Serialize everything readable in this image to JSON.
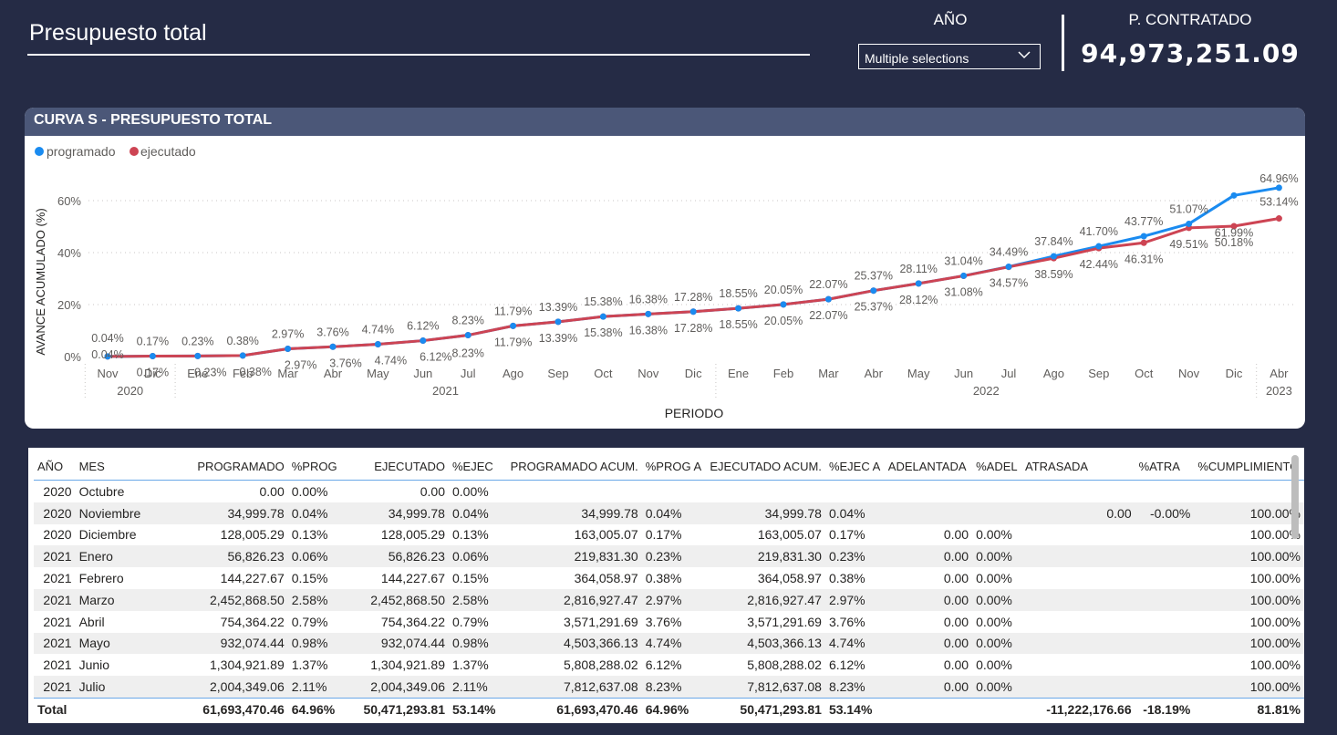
{
  "header": {
    "title": "Presupuesto total",
    "year_label": "AÑO",
    "year_select_value": "Multiple selections",
    "kpi_label": "P. CONTRATADO",
    "kpi_value": "94,973,251.09"
  },
  "chart": {
    "header_title": "CURVA S - PRESUPUESTO TOTAL"
  },
  "chart_data": {
    "type": "line",
    "title": "CURVA S - PRESUPUESTO TOTAL",
    "xlabel": "PERIODO",
    "ylabel": "AVANCE ACUMULADO (%)",
    "ylim": [
      0,
      70
    ],
    "yticks": [
      "0%",
      "20%",
      "40%",
      "60%"
    ],
    "grid": true,
    "legend_position": "top-left",
    "categories": [
      "Nov",
      "Dic",
      "Ene",
      "Feb",
      "Mar",
      "Abr",
      "May",
      "Jun",
      "Jul",
      "Ago",
      "Sep",
      "Oct",
      "Nov",
      "Dic",
      "Ene",
      "Feb",
      "Mar",
      "Abr",
      "May",
      "Jun",
      "Jul",
      "Ago",
      "Sep",
      "Oct",
      "Nov",
      "Dic",
      "Abr"
    ],
    "year_groups": [
      {
        "label": "2020",
        "start": 0,
        "end": 1
      },
      {
        "label": "2021",
        "start": 2,
        "end": 13
      },
      {
        "label": "2022",
        "start": 14,
        "end": 25
      },
      {
        "label": "2023",
        "start": 26,
        "end": 26
      }
    ],
    "series": [
      {
        "name": "programado",
        "color": "#1a8bf0",
        "values": [
          0.04,
          0.17,
          0.23,
          0.38,
          2.97,
          3.76,
          4.74,
          6.12,
          8.23,
          11.79,
          13.39,
          15.38,
          16.38,
          17.28,
          18.55,
          20.05,
          22.07,
          25.37,
          28.12,
          31.08,
          34.57,
          38.59,
          42.44,
          46.31,
          51.07,
          61.99,
          64.96
        ],
        "labels": [
          "0.04%",
          "0.17%",
          "0.23%",
          "0.38%",
          "2.97%",
          "3.76%",
          "4.74%",
          "6.12%",
          "8.23%",
          "11.79%",
          "13.39%",
          "15.38%",
          "16.38%",
          "17.28%",
          "18.55%",
          "20.05%",
          "22.07%",
          "25.37%",
          "28.12%",
          "31.08%",
          "34.57%",
          "38.59%",
          "42.44%",
          "46.31%",
          "51.07%",
          "61.99%",
          "64.96%"
        ]
      },
      {
        "name": "ejecutado",
        "color": "#cd4453",
        "values": [
          0.04,
          0.17,
          0.23,
          0.38,
          2.97,
          3.76,
          4.74,
          6.12,
          8.23,
          11.79,
          13.39,
          15.38,
          16.38,
          17.28,
          18.55,
          20.05,
          22.07,
          25.37,
          28.11,
          31.04,
          34.49,
          37.84,
          41.7,
          43.77,
          49.51,
          50.18,
          53.14
        ],
        "labels": [
          "0.04%",
          "0.17%",
          "0.23%",
          "0.38%",
          "2.97%",
          "3.76%",
          "4.74%",
          "6.12%",
          "8.23%",
          "11.79%",
          "13.39%",
          "15.38%",
          "16.38%",
          "17.28%",
          "18.55%",
          "20.05%",
          "22.07%",
          "25.37%",
          "28.11%",
          "31.04%",
          "34.49%",
          "37.84%",
          "41.70%",
          "43.77%",
          "49.51%",
          "50.18%",
          "53.14%"
        ]
      }
    ]
  },
  "table": {
    "columns": [
      "AÑO",
      "MES",
      "PROGRAMADO",
      "%PROG",
      "EJECUTADO",
      "%EJEC",
      "PROGRAMADO ACUM.",
      "%PROG A",
      "EJECUTADO ACUM.",
      "%EJEC A",
      "ADELANTADA",
      "%ADEL",
      "ATRASADA",
      "%ATRA",
      "%CUMPLIMIENTO"
    ],
    "rows": [
      [
        "2020",
        "Octubre",
        "0.00",
        "0.00%",
        "0.00",
        "0.00%",
        "",
        "",
        "",
        "",
        "",
        "",
        "",
        "",
        ""
      ],
      [
        "2020",
        "Noviembre",
        "34,999.78",
        "0.04%",
        "34,999.78",
        "0.04%",
        "34,999.78",
        "0.04%",
        "34,999.78",
        "0.04%",
        "",
        "",
        "0.00",
        "-0.00%",
        "100.00%"
      ],
      [
        "2020",
        "Diciembre",
        "128,005.29",
        "0.13%",
        "128,005.29",
        "0.13%",
        "163,005.07",
        "0.17%",
        "163,005.07",
        "0.17%",
        "0.00",
        "0.00%",
        "",
        "",
        "100.00%"
      ],
      [
        "2021",
        "Enero",
        "56,826.23",
        "0.06%",
        "56,826.23",
        "0.06%",
        "219,831.30",
        "0.23%",
        "219,831.30",
        "0.23%",
        "0.00",
        "0.00%",
        "",
        "",
        "100.00%"
      ],
      [
        "2021",
        "Febrero",
        "144,227.67",
        "0.15%",
        "144,227.67",
        "0.15%",
        "364,058.97",
        "0.38%",
        "364,058.97",
        "0.38%",
        "0.00",
        "0.00%",
        "",
        "",
        "100.00%"
      ],
      [
        "2021",
        "Marzo",
        "2,452,868.50",
        "2.58%",
        "2,452,868.50",
        "2.58%",
        "2,816,927.47",
        "2.97%",
        "2,816,927.47",
        "2.97%",
        "0.00",
        "0.00%",
        "",
        "",
        "100.00%"
      ],
      [
        "2021",
        "Abril",
        "754,364.22",
        "0.79%",
        "754,364.22",
        "0.79%",
        "3,571,291.69",
        "3.76%",
        "3,571,291.69",
        "3.76%",
        "0.00",
        "0.00%",
        "",
        "",
        "100.00%"
      ],
      [
        "2021",
        "Mayo",
        "932,074.44",
        "0.98%",
        "932,074.44",
        "0.98%",
        "4,503,366.13",
        "4.74%",
        "4,503,366.13",
        "4.74%",
        "0.00",
        "0.00%",
        "",
        "",
        "100.00%"
      ],
      [
        "2021",
        "Junio",
        "1,304,921.89",
        "1.37%",
        "1,304,921.89",
        "1.37%",
        "5,808,288.02",
        "6.12%",
        "5,808,288.02",
        "6.12%",
        "0.00",
        "0.00%",
        "",
        "",
        "100.00%"
      ],
      [
        "2021",
        "Julio",
        "2,004,349.06",
        "2.11%",
        "2,004,349.06",
        "2.11%",
        "7,812,637.08",
        "8.23%",
        "7,812,637.08",
        "8.23%",
        "0.00",
        "0.00%",
        "",
        "",
        "100.00%"
      ]
    ],
    "total": [
      "Total",
      "",
      "61,693,470.46",
      "64.96%",
      "50,471,293.81",
      "53.14%",
      "61,693,470.46",
      "64.96%",
      "50,471,293.81",
      "53.14%",
      "",
      "",
      "-11,222,176.66",
      "-18.19%",
      "81.81%"
    ]
  }
}
